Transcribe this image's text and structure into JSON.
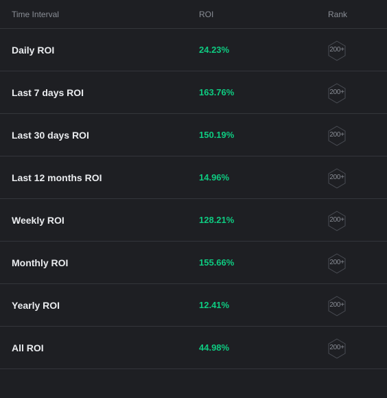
{
  "columns": {
    "interval": "Time Interval",
    "roi": "ROI",
    "rank": "Rank"
  },
  "rows": [
    {
      "label": "Daily ROI",
      "roi": "24.23%",
      "rank": "200+"
    },
    {
      "label": "Last 7 days ROI",
      "roi": "163.76%",
      "rank": "200+"
    },
    {
      "label": "Last 30 days ROI",
      "roi": "150.19%",
      "rank": "200+"
    },
    {
      "label": "Last 12 months ROI",
      "roi": "14.96%",
      "rank": "200+"
    },
    {
      "label": "Weekly ROI",
      "roi": "128.21%",
      "rank": "200+"
    },
    {
      "label": "Monthly ROI",
      "roi": "155.66%",
      "rank": "200+"
    },
    {
      "label": "Yearly ROI",
      "roi": "12.41%",
      "rank": "200+"
    },
    {
      "label": "All ROI",
      "roi": "44.98%",
      "rank": "200+"
    }
  ],
  "colors": {
    "positive": "#0ecb81",
    "background": "#1e1f23",
    "divider": "#34363b",
    "muted": "#8a8e96"
  }
}
